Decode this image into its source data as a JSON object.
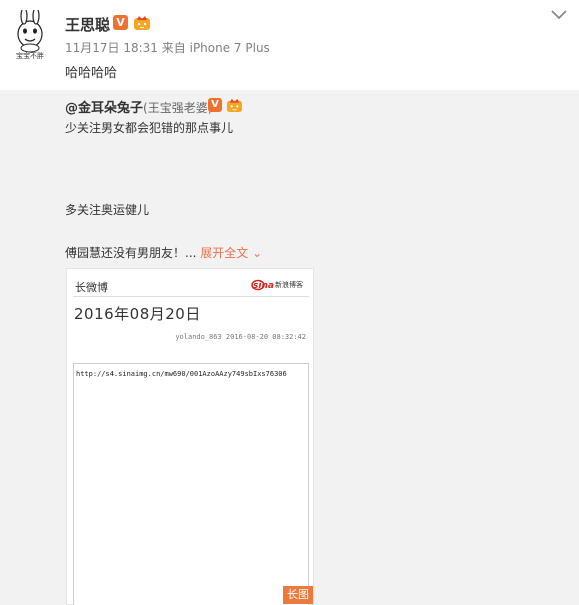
{
  "post": {
    "author": "王思聪",
    "verified_badge": "V",
    "timestamp": "11月17日 18:31",
    "source_prefix": "来自",
    "source": "iPhone 7 Plus",
    "text": "哈哈哈哈",
    "avatar_caption": "宝宝不胖"
  },
  "repost": {
    "author_handle": "@金耳朵兔子",
    "author_note": "(王宝强老婆)",
    "verified_badge": "V",
    "line1": "少关注男女都会犯错的那点事儿",
    "line2": "多关注奥运健儿",
    "line3": "傅园慧还没有男朋友！...",
    "expand_label": "展开全文",
    "long_image": {
      "label": "长微博",
      "brand": "新浪博客",
      "date": "2016年08月20日",
      "author_line": "yolando_863  2016-08-20 08:32:42",
      "url": "http://s4.sinaimg.cn/mw690/001AzoAAzy749sbIxs76306",
      "tag": "长图"
    }
  },
  "colors": {
    "verified": "#f2702e",
    "link": "#eb7350",
    "quoted_bg": "#f2f2f2",
    "long_tag": "#ec7a3e"
  }
}
